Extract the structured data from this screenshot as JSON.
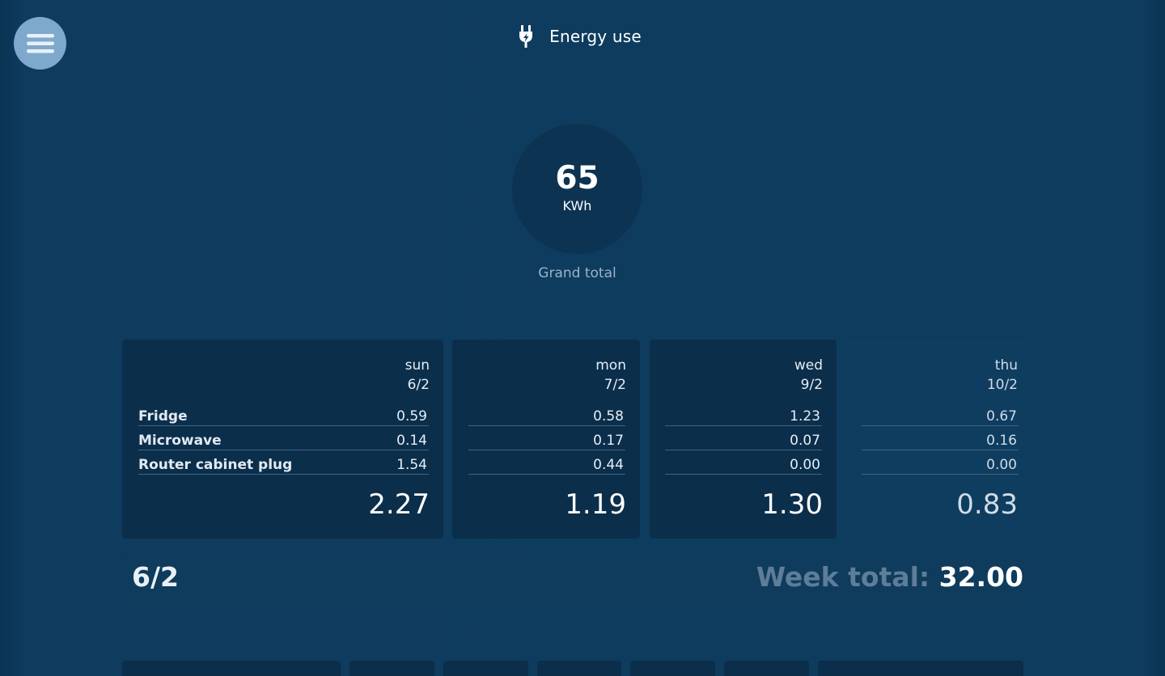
{
  "header": {
    "icon": "plug-icon",
    "title": "Energy use"
  },
  "menu": {
    "icon": "hamburger-menu-icon"
  },
  "grand_total": {
    "value": "65",
    "unit": "KWh",
    "label": "Grand total"
  },
  "days": [
    {
      "weekday": "sun",
      "date": "6/2",
      "rows": [
        {
          "name": "Fridge",
          "value": "0.59"
        },
        {
          "name": "Microwave",
          "value": "0.14"
        },
        {
          "name": "Router cabinet plug",
          "value": "1.54"
        }
      ],
      "total": "2.27"
    },
    {
      "weekday": "mon",
      "date": "7/2",
      "rows": [
        {
          "name": "",
          "value": "0.58"
        },
        {
          "name": "",
          "value": "0.17"
        },
        {
          "name": "",
          "value": "0.44"
        }
      ],
      "total": "1.19"
    },
    {
      "weekday": "wed",
      "date": "9/2",
      "rows": [
        {
          "name": "",
          "value": "1.23"
        },
        {
          "name": "",
          "value": "0.07"
        },
        {
          "name": "",
          "value": "0.00"
        }
      ],
      "total": "1.30"
    },
    {
      "weekday": "thu",
      "date": "10/2",
      "rows": [
        {
          "name": "",
          "value": "0.67"
        },
        {
          "name": "",
          "value": "0.16"
        },
        {
          "name": "",
          "value": "0.00"
        }
      ],
      "total": "0.83"
    }
  ],
  "week": {
    "label": "6/2",
    "total_label": "Week total:",
    "total_value": "32.00"
  },
  "colors": {
    "background": "#0e3c5f",
    "card": "#0b2e4b",
    "menu_button": "#7fa9cc"
  }
}
